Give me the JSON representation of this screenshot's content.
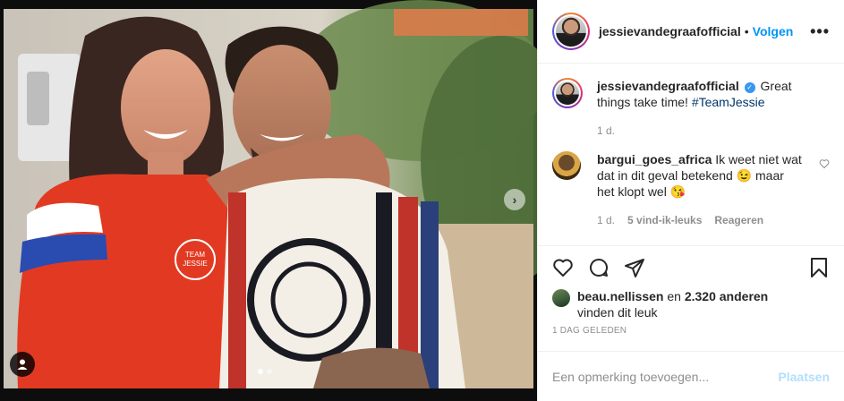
{
  "post": {
    "author": "jessievandegraafofficial",
    "follow_label": "Volgen",
    "separator": "•",
    "more_label": "•••",
    "caption_username": "jessievandegraafofficial",
    "caption_text": "Great things take time! ",
    "caption_hashtag": "#TeamJessie",
    "caption_age": "1 d.",
    "verified_glyph": "✓"
  },
  "comment": {
    "username": "bargui_goes_africa",
    "text": "Ik weet niet wat dat in dit geval betekend 😉 maar het klopt wel 😘",
    "age": "1 d.",
    "likes_label": "5 vind-ik-leuks",
    "reply_label": "Reageren"
  },
  "likes": {
    "user": "beau.nellissen",
    "connector": " en ",
    "count": "2.320 anderen",
    "suffix": "vinden dit leuk"
  },
  "timestamp": "1 DAG GELEDEN",
  "add_comment": {
    "placeholder": "Een opmerking toevoegen...",
    "post_label": "Plaatsen"
  },
  "carousel": {
    "next_glyph": "›",
    "total_slides": 2,
    "current_slide": 1
  },
  "colors": {
    "follow_blue": "#0095f6",
    "hashtag_blue": "#00376b",
    "post_button_disabled": "#b2dffc",
    "meta_gray": "#8e8e8e",
    "text_dark": "#262626"
  },
  "icons": {
    "actions": [
      "heart-icon",
      "comment-icon",
      "share-icon",
      "bookmark-icon"
    ],
    "header_more": "more-options-icon",
    "photo_overlay": [
      "user-tag-icon",
      "chevron-right-icon"
    ]
  }
}
